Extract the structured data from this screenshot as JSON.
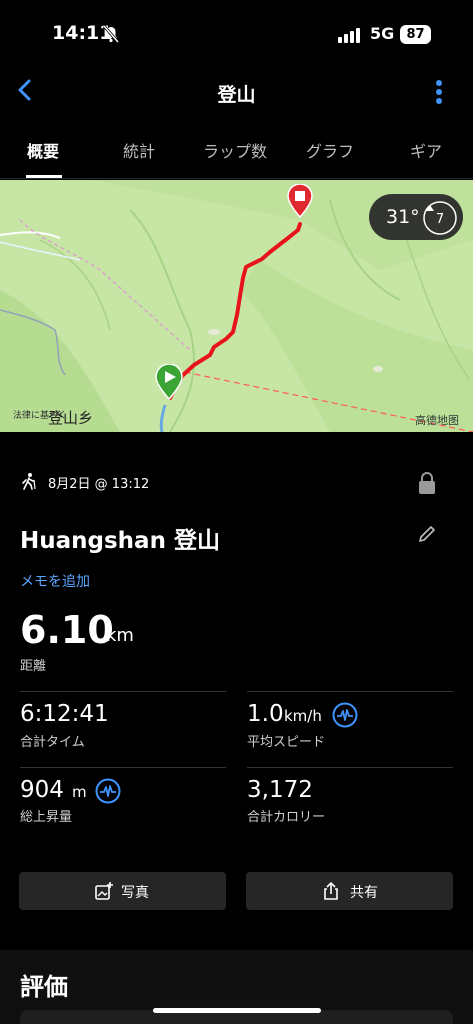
{
  "status": {
    "time": "14:11",
    "network": "5G",
    "battery": "87"
  },
  "nav": {
    "title": "登山"
  },
  "tabs": [
    {
      "label": "概要"
    },
    {
      "label": "統計"
    },
    {
      "label": "ラップ数"
    },
    {
      "label": "グラフ"
    },
    {
      "label": "ギア"
    }
  ],
  "map": {
    "temperature": "31°",
    "wind_value": "7",
    "place_label": "登山乡",
    "attribution": "高德地图",
    "law_text": "法律に基づく"
  },
  "activity": {
    "date": "8月2日 @ 13:12",
    "title": "Huangshan 登山",
    "add_memo": "メモを追加",
    "distance_value": "6.10",
    "distance_unit": "km",
    "distance_label": "距離"
  },
  "stats": {
    "total_time_value": "6:12:41",
    "total_time_label": "合計タイム",
    "avg_speed_value": "1.0",
    "avg_speed_unit": "km/h",
    "avg_speed_label": "平均スピード",
    "ascent_value": "904",
    "ascent_unit": "m",
    "ascent_label": "総上昇量",
    "calories_value": "3,172",
    "calories_label": "合計カロリー"
  },
  "buttons": {
    "photo": "写真",
    "share": "共有"
  },
  "rating": {
    "title": "評価"
  },
  "colors": {
    "accent": "#5aa7ff",
    "route": "#e8141b",
    "map_green": "#c8e7a6",
    "start": "#3aa535",
    "end": "#e0282f"
  },
  "icons": [
    "bell-muted-icon",
    "back-chevron-icon",
    "more-vertical-icon",
    "wind-compass-icon",
    "hiking-icon",
    "lock-icon",
    "pencil-icon",
    "heart-rate-wave-icon",
    "add-photo-icon",
    "share-icon"
  ]
}
